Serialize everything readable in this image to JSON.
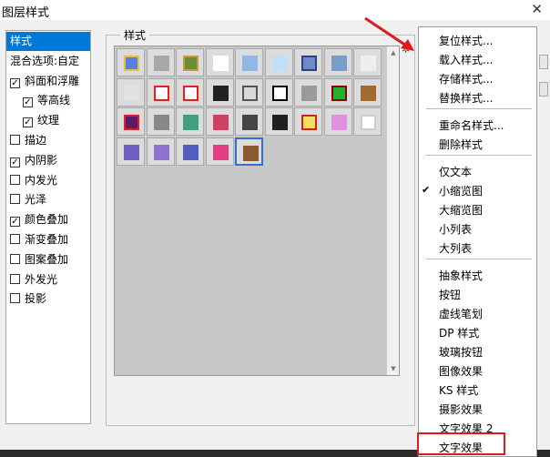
{
  "window": {
    "title": "图层样式",
    "close_glyph": "✕"
  },
  "left_panel": {
    "items": [
      {
        "label": "样式",
        "checked": null,
        "indent": 0,
        "selected": true
      },
      {
        "label": "混合选项:自定",
        "checked": null,
        "indent": 0,
        "selected": false
      },
      {
        "label": "斜面和浮雕",
        "checked": true,
        "indent": 0,
        "selected": false
      },
      {
        "label": "等高线",
        "checked": true,
        "indent": 1,
        "selected": false
      },
      {
        "label": "纹理",
        "checked": true,
        "indent": 1,
        "selected": false
      },
      {
        "label": "描边",
        "checked": false,
        "indent": 0,
        "selected": false
      },
      {
        "label": "内阴影",
        "checked": true,
        "indent": 0,
        "selected": false
      },
      {
        "label": "内发光",
        "checked": false,
        "indent": 0,
        "selected": false
      },
      {
        "label": "光泽",
        "checked": false,
        "indent": 0,
        "selected": false
      },
      {
        "label": "颜色叠加",
        "checked": true,
        "indent": 0,
        "selected": false
      },
      {
        "label": "渐变叠加",
        "checked": false,
        "indent": 0,
        "selected": false
      },
      {
        "label": "图案叠加",
        "checked": false,
        "indent": 0,
        "selected": false
      },
      {
        "label": "外发光",
        "checked": false,
        "indent": 0,
        "selected": false
      },
      {
        "label": "投影",
        "checked": false,
        "indent": 0,
        "selected": false
      }
    ]
  },
  "styles_group": {
    "label": "样式",
    "gear_glyph": "✲"
  },
  "swatches": [
    {
      "name": "blue-square-swatch",
      "color": "#5b7fe0",
      "ring": "#e8c040",
      "selected": false
    },
    {
      "name": "gray-bevel-swatch",
      "color": "#a8a8a8",
      "ring": "",
      "selected": false
    },
    {
      "name": "noise-pattern-swatch",
      "color": "#6a8c3a",
      "ring": "#c0a030",
      "selected": false
    },
    {
      "name": "white-glow-swatch",
      "color": "#ffffff",
      "ring": "",
      "selected": false
    },
    {
      "name": "light-blue-swatch",
      "color": "#8fb8e8",
      "ring": "",
      "selected": false
    },
    {
      "name": "sky-gradient-swatch",
      "color": "#bfe0f8",
      "ring": "",
      "selected": false
    },
    {
      "name": "blue-frame-swatch",
      "color": "#6b8cc8",
      "ring": "#30407a",
      "selected": false
    },
    {
      "name": "landscape-swatch",
      "color": "#7a9cc8",
      "ring": "",
      "selected": false
    },
    {
      "name": "silver-swatch",
      "color": "#eeeeee",
      "ring": "",
      "selected": false
    },
    {
      "name": "light-gray-swatch",
      "color": "#e2e2e2",
      "ring": "",
      "selected": false
    },
    {
      "name": "red-frame-bold-swatch",
      "color": "#ffffff",
      "ring": "#e02020",
      "selected": false
    },
    {
      "name": "red-frame-thin-swatch",
      "color": "#ffffff",
      "ring": "#e02020",
      "selected": false
    },
    {
      "name": "black-diagonal-swatch",
      "color": "#222222",
      "ring": "",
      "selected": false
    },
    {
      "name": "gray-ring-swatch",
      "color": "#d8d8d8",
      "ring": "#555555",
      "selected": false
    },
    {
      "name": "black-frame-swatch",
      "color": "#ffffff",
      "ring": "#000000",
      "selected": false
    },
    {
      "name": "gray-square-swatch",
      "color": "#9a9a9a",
      "ring": "",
      "selected": false
    },
    {
      "name": "green-square-swatch",
      "color": "#22b030",
      "ring": "#900000",
      "selected": false
    },
    {
      "name": "rust-texture-swatch",
      "color": "#a06a30",
      "ring": "",
      "selected": false
    },
    {
      "name": "purple-glow-swatch",
      "color": "#5a1a6a",
      "ring": "#e02020",
      "selected": false
    },
    {
      "name": "speckle-swatch",
      "color": "#888888",
      "ring": "",
      "selected": false
    },
    {
      "name": "rainbow-stripe-swatch",
      "color": "#40a080",
      "ring": "",
      "selected": false
    },
    {
      "name": "pinwheel-swatch",
      "color": "#d04060",
      "ring": "",
      "selected": false
    },
    {
      "name": "dark-gray-swatch",
      "color": "#444444",
      "ring": "",
      "selected": false
    },
    {
      "name": "black-bevel-swatch",
      "color": "#202020",
      "ring": "",
      "selected": false
    },
    {
      "name": "red-yellow-swatch",
      "color": "#f0e060",
      "ring": "#d02020",
      "selected": false
    },
    {
      "name": "pink-blue-swatch",
      "color": "#e090e0",
      "ring": "",
      "selected": false
    },
    {
      "name": "white-outline-swatch",
      "color": "#ffffff",
      "ring": "#cccccc",
      "selected": false
    },
    {
      "name": "violet-square-swatch",
      "color": "#7060c0",
      "ring": "",
      "selected": false
    },
    {
      "name": "violet-glow-swatch",
      "color": "#9070d0",
      "ring": "",
      "selected": false
    },
    {
      "name": "indigo-square-swatch",
      "color": "#5060c0",
      "ring": "",
      "selected": false
    },
    {
      "name": "sunset-swatch",
      "color": "#e04080",
      "ring": "",
      "selected": false
    },
    {
      "name": "wood-texture-swatch",
      "color": "#8a5a30",
      "ring": "",
      "selected": true
    }
  ],
  "scrollbar": {
    "up_glyph": "▲",
    "down_glyph": "▼"
  },
  "menu": {
    "items": [
      {
        "label": "复位样式...",
        "sep_after": false
      },
      {
        "label": "载入样式...",
        "sep_after": false
      },
      {
        "label": "存储样式...",
        "sep_after": false
      },
      {
        "label": "替换样式...",
        "sep_after": true
      },
      {
        "label": "重命名样式...",
        "sep_after": false
      },
      {
        "label": "删除样式",
        "sep_after": true
      },
      {
        "label": "仅文本",
        "sep_after": false
      },
      {
        "label": "小缩览图",
        "sep_after": false,
        "checked": true
      },
      {
        "label": "大缩览图",
        "sep_after": false
      },
      {
        "label": "小列表",
        "sep_after": false
      },
      {
        "label": "大列表",
        "sep_after": true
      },
      {
        "label": "抽象样式",
        "sep_after": false
      },
      {
        "label": "按钮",
        "sep_after": false
      },
      {
        "label": "虚线笔划",
        "sep_after": false
      },
      {
        "label": "DP 样式",
        "sep_after": false
      },
      {
        "label": "玻璃按钮",
        "sep_after": false
      },
      {
        "label": "图像效果",
        "sep_after": false
      },
      {
        "label": "KS 样式",
        "sep_after": false
      },
      {
        "label": "摄影效果",
        "sep_after": false
      },
      {
        "label": "文字效果 2",
        "sep_after": false
      },
      {
        "label": "文字效果",
        "sep_after": false
      }
    ],
    "check_glyph": "✔"
  },
  "colors": {
    "highlight": "#e0191e",
    "selection": "#0078d7"
  }
}
